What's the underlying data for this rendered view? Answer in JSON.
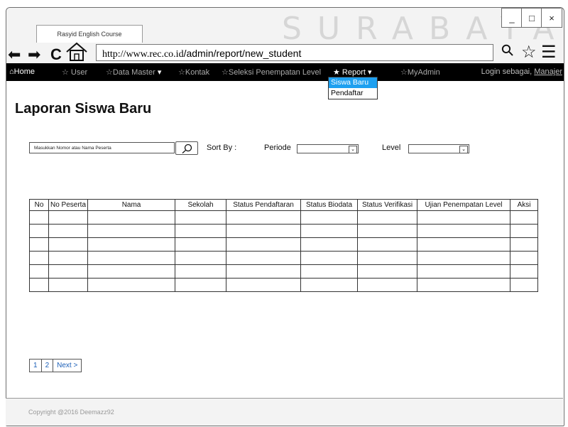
{
  "browser": {
    "tab_title": "Rasyid English Course",
    "watermark": "SURABAYA",
    "url_host": "http://www.rec.co.id",
    "url_path": "/admin/report/new_student",
    "window_minimize": "_",
    "window_maximize": "□",
    "window_close": "×",
    "back_icon": "⬅",
    "forward_icon": "➡",
    "reload_icon": "C",
    "search_icon": "⚲",
    "star_icon": "☆",
    "menu_icon": "☰"
  },
  "nav": {
    "home": "⌂Home",
    "user": "☆ User",
    "data_master": "☆Data Master",
    "kontak": "☆Kontak",
    "seleksi": "☆Seleksi Penempatan Level",
    "report": "★ Report",
    "myadmin": "☆MyAdmin",
    "login_prefix": "Login sebagai, ",
    "login_user": "Manajer",
    "dropdown_marker": "▾"
  },
  "report_menu": [
    "Siswa Baru",
    "Pendaftar"
  ],
  "page": {
    "title": "Laporan Siswa Baru",
    "search_placeholder": "Masukkan Nomor atau Nama Peserta",
    "sort_by": "Sort By :",
    "periode": "Periode",
    "level": "Level",
    "select_arrow": "⌄"
  },
  "table": {
    "headers": [
      "No",
      "No Peserta",
      "Nama",
      "Sekolah",
      "Status Pendaftaran",
      "Status Biodata",
      "Status Verifikasi",
      "Ujian Penempatan Level",
      "Aksi"
    ]
  },
  "pagination": [
    "1",
    "2",
    "Next >"
  ],
  "footer": {
    "copyright": "Copyright @2016 Deemazz92"
  }
}
